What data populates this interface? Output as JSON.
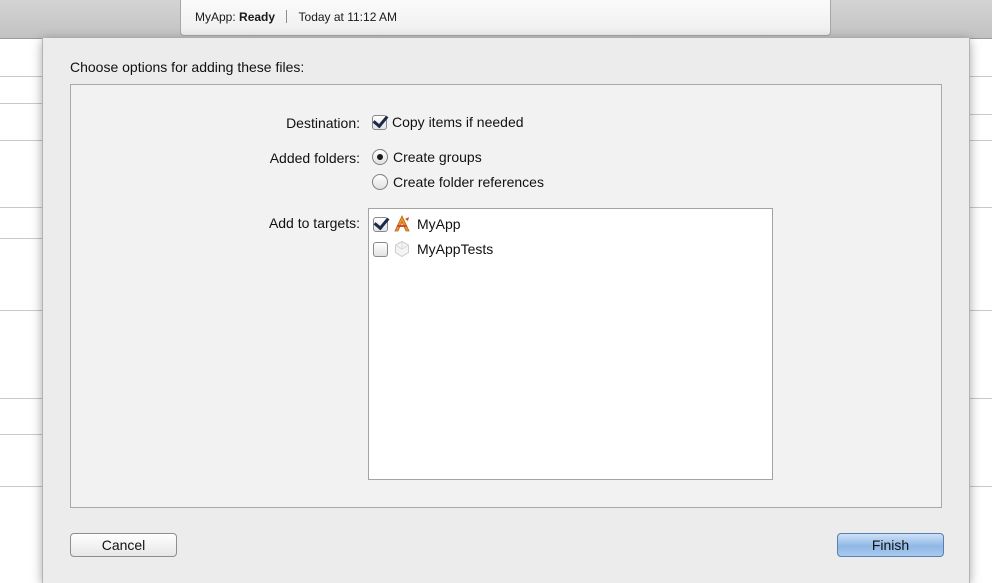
{
  "activity": {
    "app_name": "MyApp:",
    "status": "Ready",
    "timestamp": "Today at 11:12 AM"
  },
  "dialog": {
    "title": "Choose options for adding these files:",
    "destination": {
      "label": "Destination:",
      "option_label": "Copy items if needed",
      "checked": true
    },
    "added_folders": {
      "label": "Added folders:",
      "options": [
        {
          "label": "Create groups",
          "selected": true
        },
        {
          "label": "Create folder references",
          "selected": false
        }
      ]
    },
    "add_to_targets": {
      "label": "Add to targets:",
      "targets": [
        {
          "name": "MyApp",
          "checked": true,
          "icon": "app-target-icon"
        },
        {
          "name": "MyAppTests",
          "checked": false,
          "icon": "test-target-icon"
        }
      ]
    },
    "buttons": {
      "cancel": "Cancel",
      "finish": "Finish"
    }
  },
  "colors": {
    "default_button": "#8fb8e6",
    "app_icon_orange": "#e8962a",
    "app_icon_red": "#d04a2b"
  }
}
